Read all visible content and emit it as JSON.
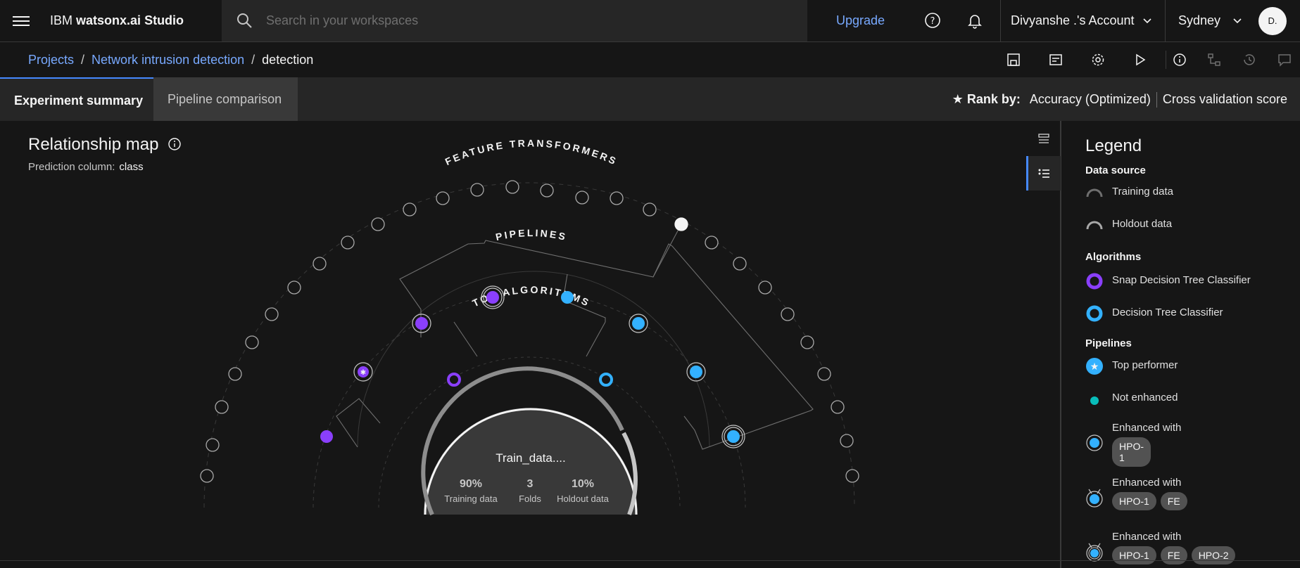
{
  "app": {
    "brand_prefix": "IBM",
    "brand_name": "watsonx.ai Studio"
  },
  "search": {
    "placeholder": "Search in your workspaces"
  },
  "header": {
    "upgrade_label": "Upgrade",
    "account_label": "Divyanshe .'s Account",
    "region_label": "Sydney",
    "avatar_initials": "D."
  },
  "breadcrumb": {
    "items": [
      "Projects",
      "Network intrusion detection",
      "detection"
    ]
  },
  "tabs": [
    {
      "label": "Experiment summary"
    },
    {
      "label": "Pipeline comparison"
    }
  ],
  "rank": {
    "label": "Rank by:",
    "metric": "Accuracy (Optimized)",
    "score": "Cross validation score"
  },
  "map": {
    "title": "Relationship map",
    "prediction_label": "Prediction column:",
    "prediction_value": "class",
    "ring_labels": {
      "feature_transformers": "FEATURE TRANSFORMERS",
      "pipelines": "PIPELINES",
      "top_algorithms": "TOP ALGORITHMS"
    },
    "center": {
      "name": "Train_data....",
      "training_pct": "90%",
      "training_label": "Training data",
      "folds": "3",
      "folds_label": "Folds",
      "holdout_pct": "10%",
      "holdout_label": "Holdout data"
    }
  },
  "legend": {
    "title": "Legend",
    "data_source_heading": "Data source",
    "training_data": "Training data",
    "holdout_data": "Holdout data",
    "algorithms_heading": "Algorithms",
    "algo1": "Snap Decision Tree Classifier",
    "algo2": "Decision Tree Classifier",
    "pipelines_heading": "Pipelines",
    "top_performer": "Top performer",
    "not_enhanced": "Not enhanced",
    "enhanced_with": "Enhanced with",
    "tag_hpo1": "HPO-1",
    "tag_fe": "FE",
    "tag_hpo2": "HPO-2"
  },
  "colors": {
    "purple": "#8a3ffc",
    "blue": "#33b1ff",
    "link": "#78a9ff",
    "accent": "#4589ff"
  }
}
